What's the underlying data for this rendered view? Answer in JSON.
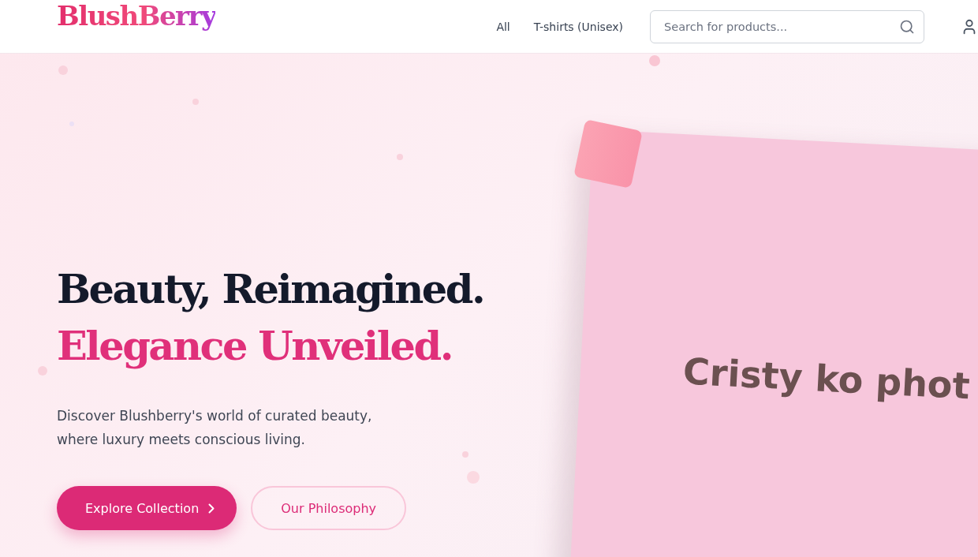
{
  "header": {
    "logo": "BlushBerry",
    "nav": [
      {
        "label": "All"
      },
      {
        "label": "T-shirts (Unisex)"
      }
    ],
    "search": {
      "placeholder": "Search for products..."
    }
  },
  "hero": {
    "headline": "Beauty, Reimagined.",
    "accent": "Elegance Unveiled.",
    "description": "Discover Blushberry's world of curated beauty, where luxury meets conscious living.",
    "primary_button": "Explore Collection",
    "secondary_button": "Our Philosophy",
    "image_caption": "Cristy ko phot"
  }
}
